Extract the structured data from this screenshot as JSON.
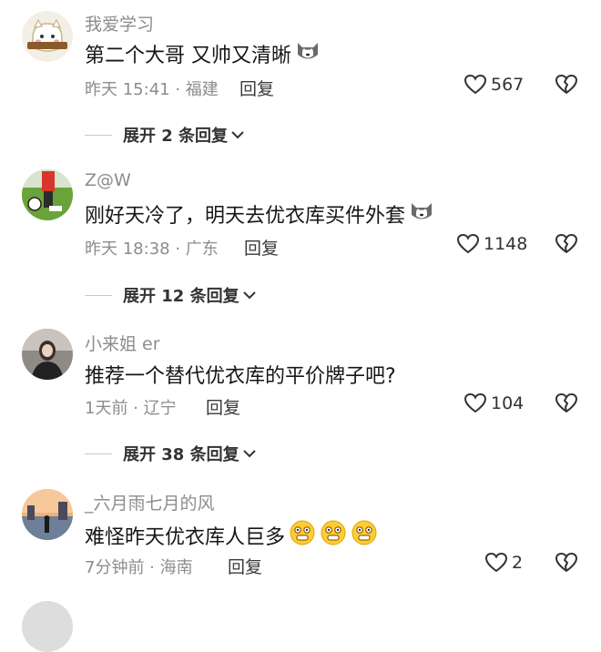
{
  "comments": [
    {
      "user": "我爱学习",
      "text": "第二个大哥 又帅又清晰",
      "emoji": "dog-face-icon",
      "meta": "昨天 15:41 · 福建",
      "reply": "回复",
      "likes": "567",
      "expand": "展开 2 条回复"
    },
    {
      "user": "Z@W",
      "text": "刚好天冷了，明天去优衣库买件外套",
      "emoji": "dog-face-icon",
      "meta": "昨天 18:38 · 广东",
      "reply": "回复",
      "likes": "1148",
      "expand": "展开 12 条回复"
    },
    {
      "user": "小来姐 er",
      "text": "推荐一个替代优衣库的平价牌子吧?",
      "meta": "1天前 · 辽宁",
      "reply": "回复",
      "likes": "104",
      "expand": "展开 38 条回复"
    },
    {
      "user": "_六月雨七月的风",
      "text": "难怪昨天优衣库人巨多",
      "emoji": "grinning-face-icon",
      "meta": "7分钟前 · 海南",
      "reply": "回复",
      "likes": "2"
    }
  ],
  "colors": {
    "secondary_text": "#8c8c8c",
    "primary_text": "#161616",
    "divider": "#c8c8c8"
  }
}
